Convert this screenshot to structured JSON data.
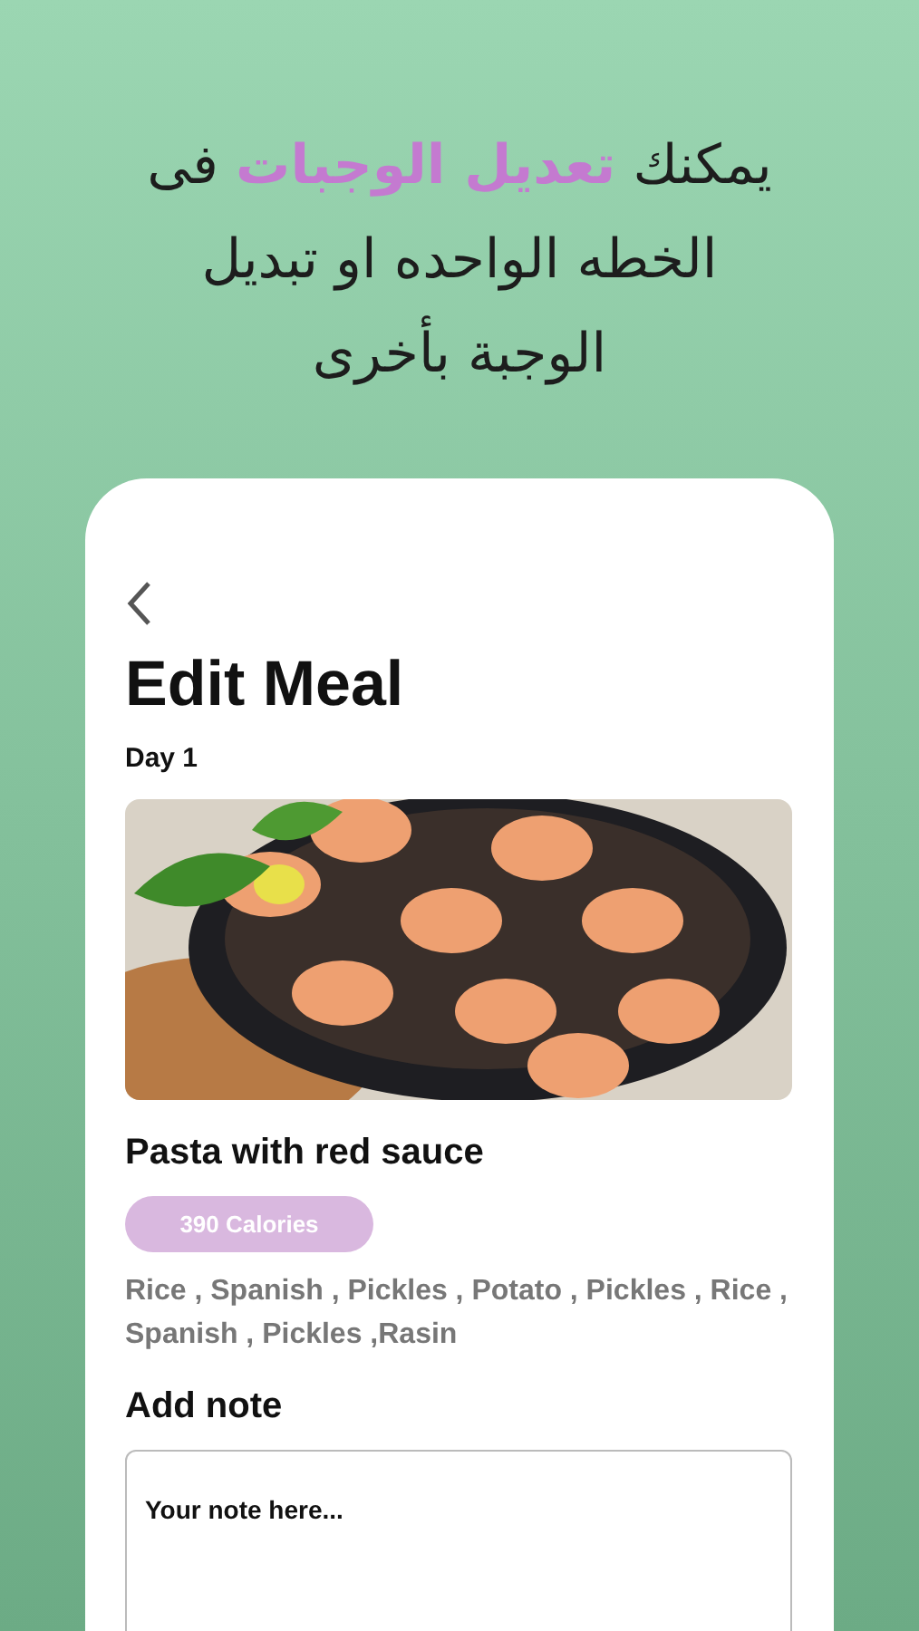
{
  "headline": [
    {
      "text": "يمكنك ",
      "highlight": false
    },
    {
      "text": "تعديل الوجبات",
      "highlight": true
    },
    {
      "text": " فى الخطه الواحده او تبديل الوجبة بأخرى",
      "highlight": false
    }
  ],
  "screen": {
    "title": "Edit Meal",
    "day": "Day 1",
    "meal_name": "Pasta with red sauce",
    "calories": "390 Calories",
    "ingredients": "Rice , Spanish , Pickles , Potato , Pickles , Rice , Spanish , Pickles ,Rasin",
    "note_label": "Add note",
    "note": {
      "placeholder": "Your note here..."
    }
  }
}
